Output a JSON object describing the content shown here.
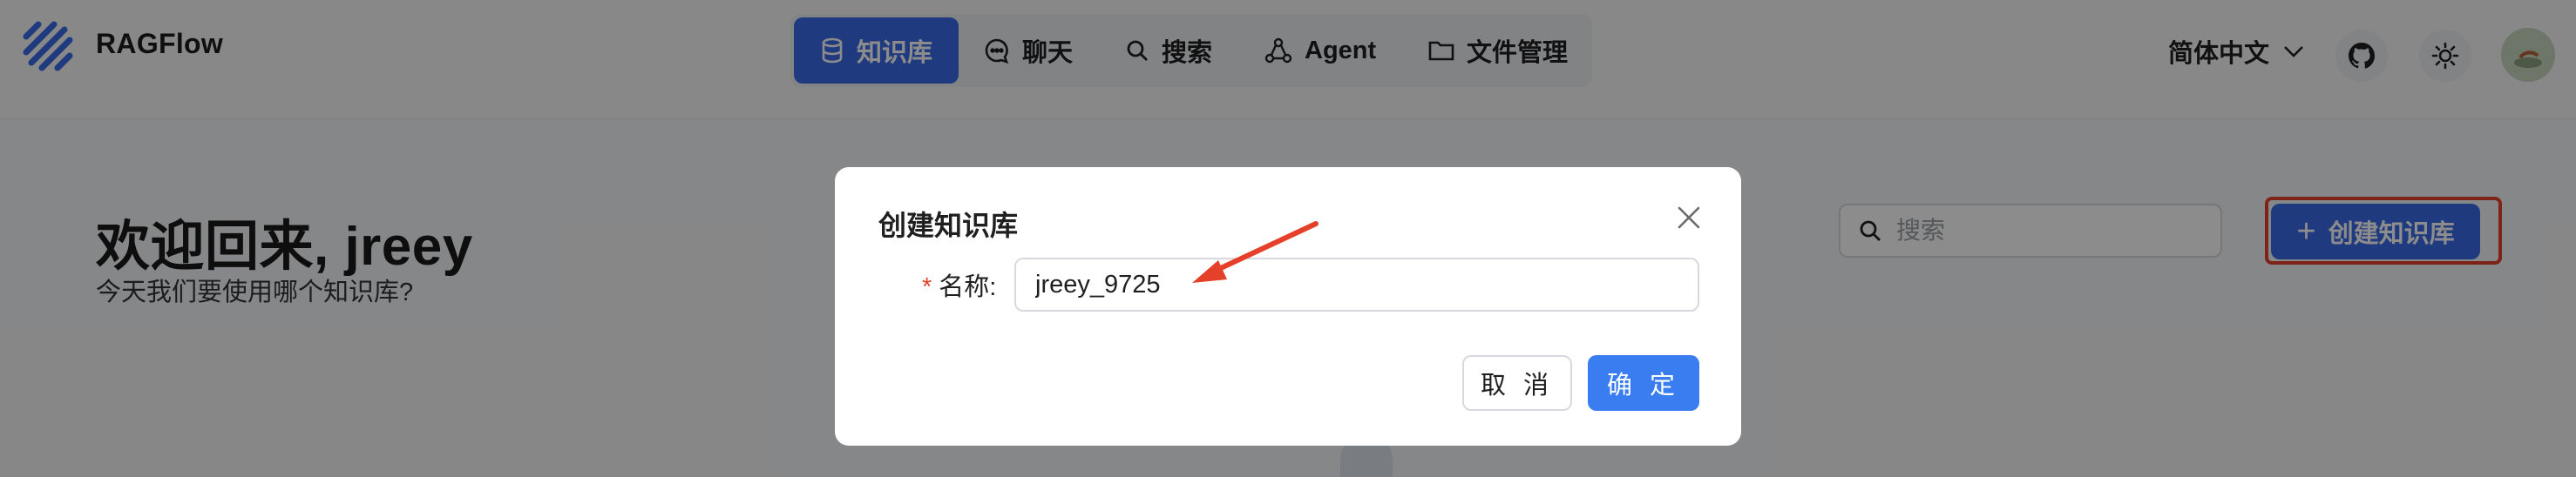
{
  "header": {
    "brand": "RAGFlow",
    "nav": [
      {
        "label": "知识库",
        "icon": "database-icon",
        "active": true
      },
      {
        "label": "聊天",
        "icon": "chat-icon"
      },
      {
        "label": "搜索",
        "icon": "search-icon"
      },
      {
        "label": "Agent",
        "icon": "agent-icon"
      },
      {
        "label": "文件管理",
        "icon": "folder-icon"
      }
    ],
    "language": "简体中文",
    "icons": [
      "github-icon",
      "sun-icon"
    ]
  },
  "page": {
    "welcome": "欢迎回来, jreey",
    "subtitle": "今天我们要使用哪个知识库?",
    "search_placeholder": "搜索",
    "create_button": "创建知识库"
  },
  "modal": {
    "title": "创建知识库",
    "name_label": "名称:",
    "name_value": "jreey_9725",
    "cancel": "取 消",
    "ok": "确 定"
  },
  "colors": {
    "primary": "#3a6ae8",
    "annotation": "#e5402a"
  }
}
